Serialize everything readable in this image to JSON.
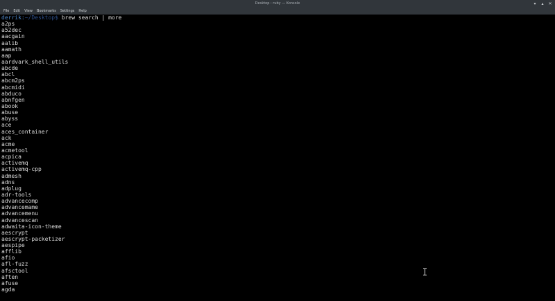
{
  "window": {
    "title": "Desktop : ruby — Konsole",
    "controls": [
      "▾",
      "▴",
      "✕"
    ]
  },
  "menu": [
    "File",
    "Edit",
    "View",
    "Bookmarks",
    "Settings",
    "Help"
  ],
  "prompt": {
    "user": "derrik",
    "separator": ":",
    "path": "~/Desktop",
    "symbol": "$",
    "command": " brew search | more"
  },
  "output_lines": [
    "a2ps",
    "a52dec",
    "aacgain",
    "aalib",
    "aamath",
    "aap",
    "aardvark_shell_utils",
    "abcde",
    "abcl",
    "abcm2ps",
    "abcmidi",
    "abduco",
    "abnfgen",
    "abook",
    "abuse",
    "abyss",
    "ace",
    "aces_container",
    "ack",
    "acme",
    "acmetool",
    "acpica",
    "activemq",
    "activemq-cpp",
    "admesh",
    "adns",
    "adplug",
    "adr-tools",
    "advancecomp",
    "advancemame",
    "advancemenu",
    "advancescan",
    "adwaita-icon-theme",
    "aescrypt",
    "aescrypt-packetizer",
    "aespipe",
    "afflib",
    "afio",
    "afl-fuzz",
    "afsctool",
    "aften",
    "afuse",
    "agda"
  ],
  "colors": {
    "background": "#000000",
    "text": "#dcdcdc",
    "prompt_user": "#4d86c8",
    "prompt_path": "#2d4f8a",
    "chrome": "#31363b"
  },
  "icons": {
    "mouse_cursor": "ibeam-cursor-icon"
  }
}
